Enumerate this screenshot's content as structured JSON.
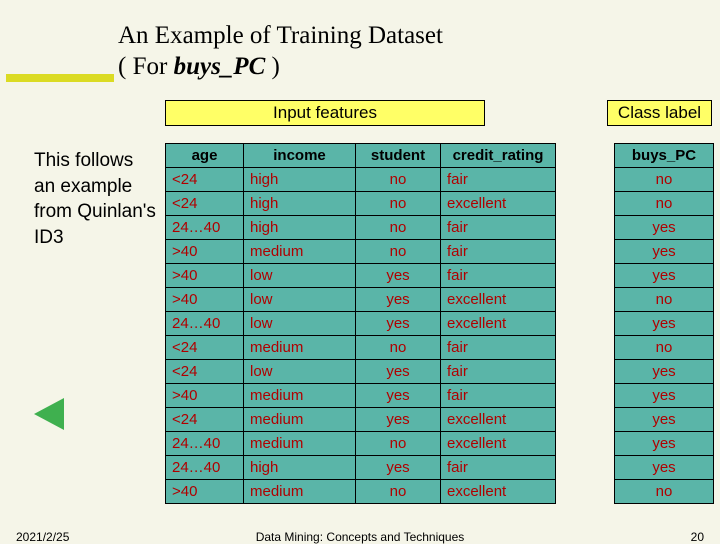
{
  "title": {
    "line1": "An Example of Training Dataset",
    "line2_pre": "( For ",
    "line2_italic": "buys_PC",
    "line2_post": " )"
  },
  "labels": {
    "input_features": "Input features",
    "class_label": "Class label"
  },
  "left_text": "This follows an example from Quinlan's ID3",
  "table": {
    "headers": [
      "age",
      "income",
      "student",
      "credit_rating",
      "buys_PC"
    ],
    "rows": [
      [
        "<24",
        "high",
        "no",
        "fair",
        "no"
      ],
      [
        "<24",
        "high",
        "no",
        "excellent",
        "no"
      ],
      [
        "24…40",
        "high",
        "no",
        "fair",
        "yes"
      ],
      [
        ">40",
        "medium",
        "no",
        "fair",
        "yes"
      ],
      [
        ">40",
        "low",
        "yes",
        "fair",
        "yes"
      ],
      [
        ">40",
        "low",
        "yes",
        "excellent",
        "no"
      ],
      [
        "24…40",
        "low",
        "yes",
        "excellent",
        "yes"
      ],
      [
        "<24",
        "medium",
        "no",
        "fair",
        "no"
      ],
      [
        "<24",
        "low",
        "yes",
        "fair",
        "yes"
      ],
      [
        ">40",
        "medium",
        "yes",
        "fair",
        "yes"
      ],
      [
        "<24",
        "medium",
        "yes",
        "excellent",
        "yes"
      ],
      [
        "24…40",
        "medium",
        "no",
        "excellent",
        "yes"
      ],
      [
        "24…40",
        "high",
        "yes",
        "fair",
        "yes"
      ],
      [
        ">40",
        "medium",
        "no",
        "excellent",
        "no"
      ]
    ]
  },
  "footer": {
    "date": "2021/2/25",
    "center": "Data Mining: Concepts and Techniques",
    "page": "20"
  }
}
